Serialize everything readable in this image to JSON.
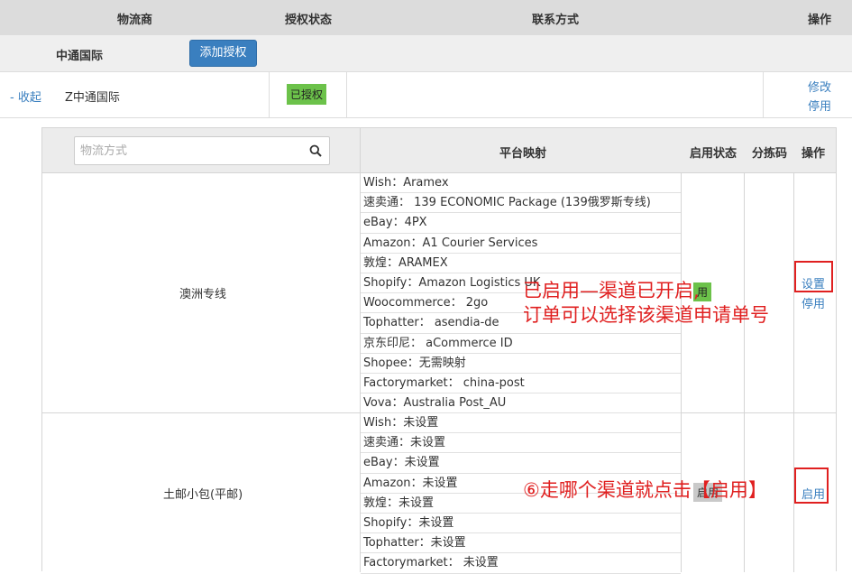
{
  "header": {
    "col_carrier": "物流商",
    "col_auth_status": "授权状态",
    "col_contact": "联系方式",
    "col_action": "操作"
  },
  "provider_bar": {
    "name": "中通国际",
    "add_auth_button": "添加授权"
  },
  "account_row": {
    "collapse_link": "- 收起",
    "name": "Z中通国际",
    "auth_badge": "已授权",
    "edit_link": "修改",
    "disable_link": "停用"
  },
  "channel_table": {
    "search": {
      "placeholder": "物流方式",
      "value": ""
    },
    "col_mapping": "平台映射",
    "col_status": "启用状态",
    "col_sort_code": "分拣码",
    "col_action": "操作",
    "channels": [
      {
        "name": "澳洲专线",
        "status": "用",
        "mappings": [
          "Wish：Aramex",
          "速卖通： 139 ECONOMIC Package (139俄罗斯专线)",
          "eBay：4PX",
          "Amazon：A1 Courier Services",
          "敦煌：ARAMEX",
          "Shopify：Amazon Logistics UK",
          "Woocommerce： 2go",
          "Tophatter： asendia-de",
          "京东印尼： aCommerce ID",
          "Shopee：无需映射",
          "Factorymarket： china-post",
          "Vova：Australia Post_AU"
        ],
        "action_primary": "设置",
        "action_secondary": "停用"
      },
      {
        "name": "土邮小包(平邮)",
        "status": "启用",
        "mappings": [
          "Wish：未设置",
          "速卖通：未设置",
          "eBay：未设置",
          "Amazon：未设置",
          "敦煌：未设置",
          "Shopify：未设置",
          "Tophatter：未设置",
          "Factorymarket： 未设置"
        ],
        "action_primary": "启用"
      }
    ]
  },
  "annotations": {
    "note1_line1": "已启用—渠道已开启,",
    "note1_line2": "订单可以选择该渠道申请单号",
    "note2": "⑥走哪个渠道就点击【启用】"
  },
  "colors": {
    "header_bg": "#dcdcdc",
    "accent_blue": "#3a7fbf",
    "badge_green": "#6cc24a",
    "annotation_red": "#e02020"
  }
}
